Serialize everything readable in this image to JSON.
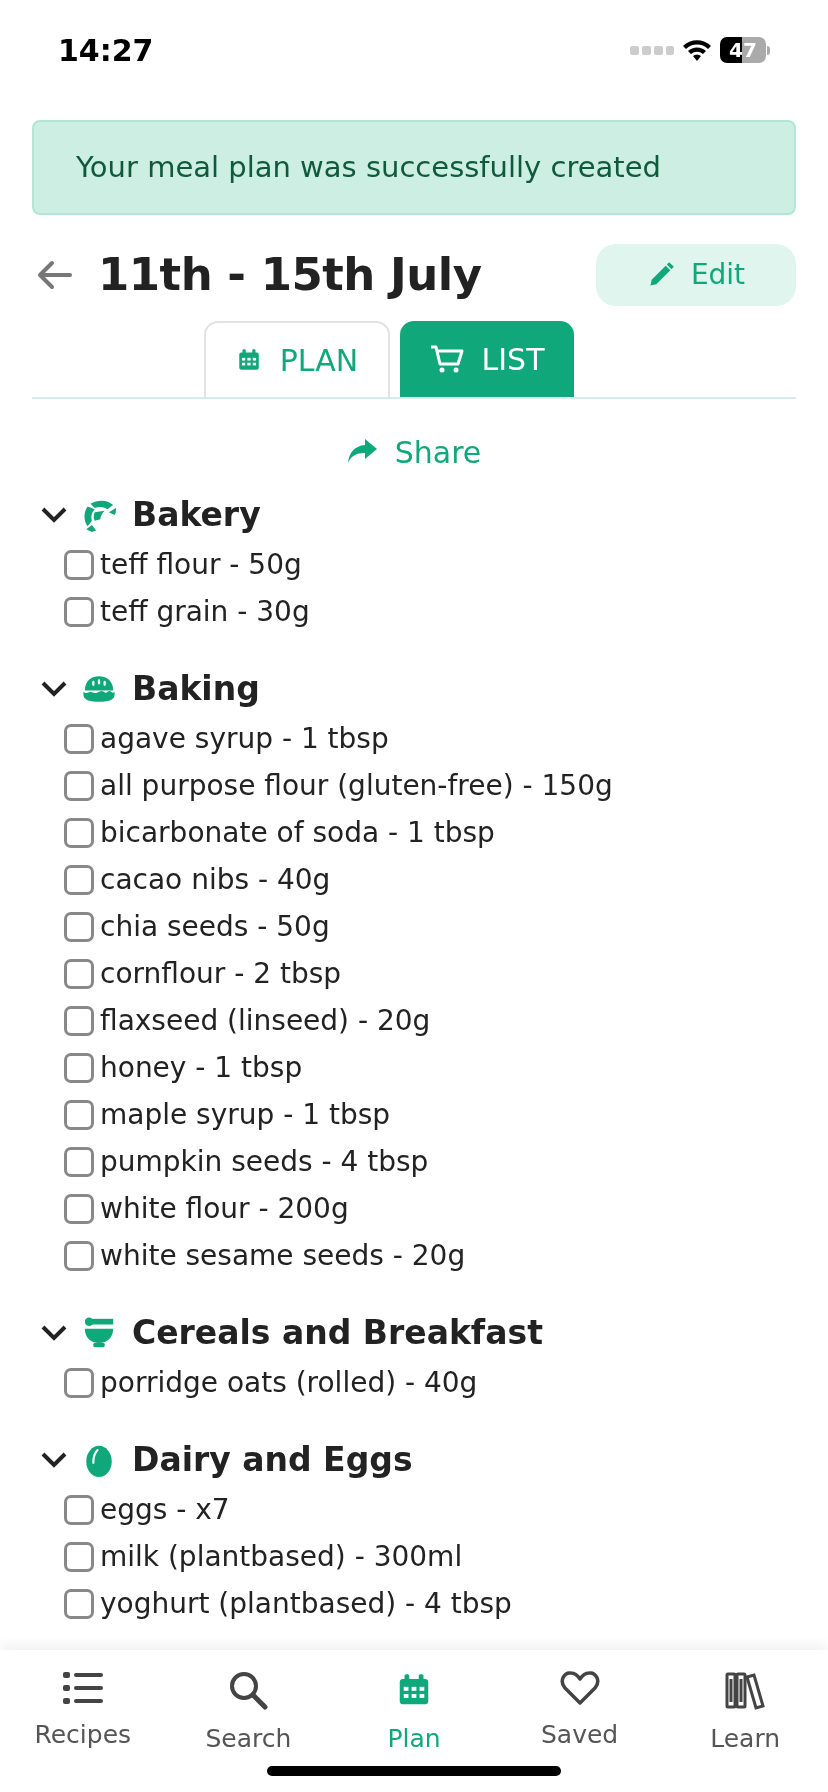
{
  "status_bar": {
    "time": "14:27",
    "battery": "47"
  },
  "banner": {
    "text": "Your meal plan was successfully created"
  },
  "header": {
    "title": "11th - 15th July",
    "edit_label": "Edit"
  },
  "tabs": [
    {
      "label": "PLAN",
      "selected": false
    },
    {
      "label": "LIST",
      "selected": true
    }
  ],
  "share": {
    "label": "Share"
  },
  "categories": [
    {
      "name": "Bakery",
      "expanded": true,
      "items": [
        {
          "label": "teff flour - 50g",
          "checked": false
        },
        {
          "label": "teff grain - 30g",
          "checked": false
        }
      ]
    },
    {
      "name": "Baking",
      "expanded": true,
      "items": [
        {
          "label": "agave syrup - 1 tbsp",
          "checked": false
        },
        {
          "label": "all purpose flour (gluten-free) - 150g",
          "checked": false
        },
        {
          "label": "bicarbonate of soda - 1 tbsp",
          "checked": false
        },
        {
          "label": "cacao nibs - 40g",
          "checked": false
        },
        {
          "label": "chia seeds - 50g",
          "checked": false
        },
        {
          "label": "cornflour - 2 tbsp",
          "checked": false
        },
        {
          "label": "flaxseed (linseed) - 20g",
          "checked": false
        },
        {
          "label": "honey - 1 tbsp",
          "checked": false
        },
        {
          "label": "maple syrup - 1 tbsp",
          "checked": false
        },
        {
          "label": "pumpkin seeds - 4 tbsp",
          "checked": false
        },
        {
          "label": "white flour - 200g",
          "checked": false
        },
        {
          "label": "white sesame seeds - 20g",
          "checked": false
        }
      ]
    },
    {
      "name": "Cereals and Breakfast",
      "expanded": true,
      "items": [
        {
          "label": "porridge oats (rolled) - 40g",
          "checked": false
        }
      ]
    },
    {
      "name": "Dairy and Eggs",
      "expanded": true,
      "items": [
        {
          "label": "eggs - x7",
          "checked": false
        },
        {
          "label": "milk (plantbased) - 300ml",
          "checked": false
        },
        {
          "label": "yoghurt (plantbased) - 4 tbsp",
          "checked": false
        }
      ]
    }
  ],
  "nav": [
    {
      "label": "Recipes",
      "selected": false
    },
    {
      "label": "Search",
      "selected": false
    },
    {
      "label": "Plan",
      "selected": true
    },
    {
      "label": "Saved",
      "selected": false
    },
    {
      "label": "Learn",
      "selected": false
    }
  ]
}
